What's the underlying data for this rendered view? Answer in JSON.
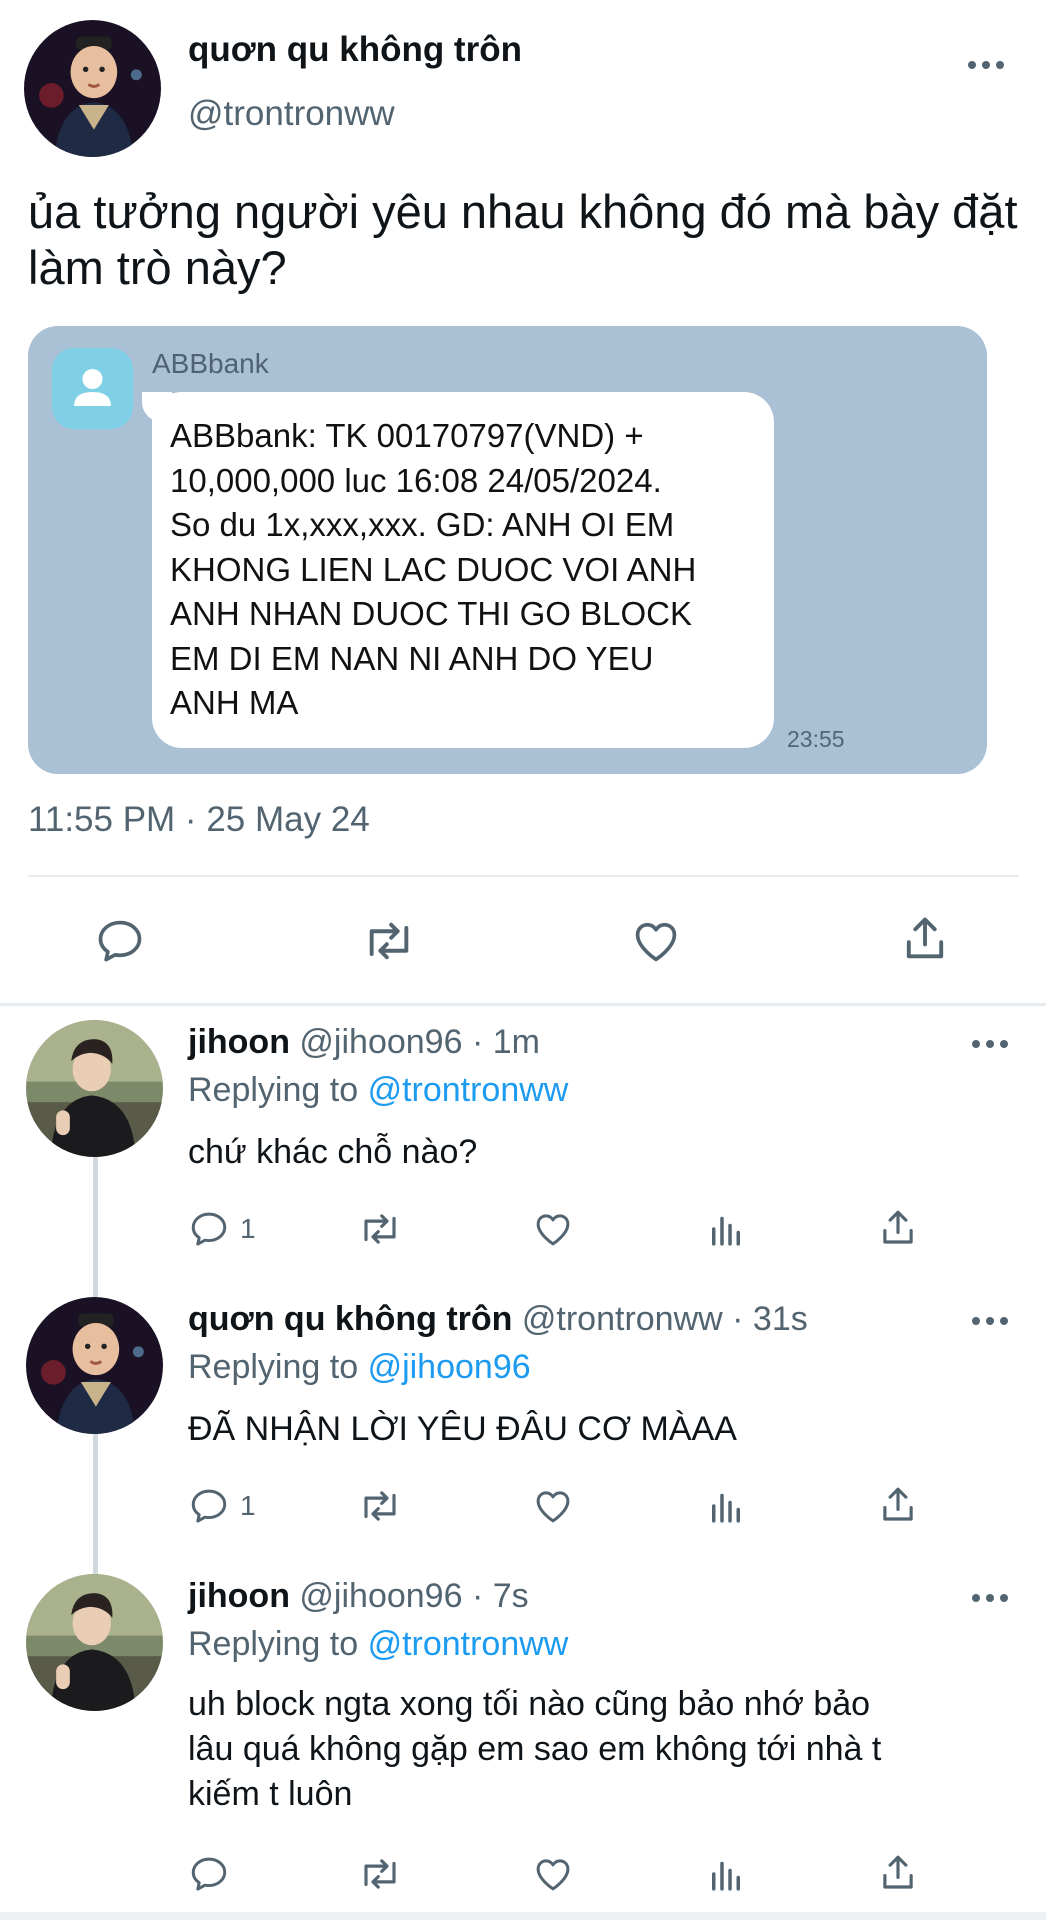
{
  "main_tweet": {
    "author_name": "quơn qu không trôn",
    "author_handle": "@trontronww",
    "text": "ủa tưởng người yêu nhau không đó mà bày đặt làm trò này?",
    "timestamp": "11:55 PM · 25 May 24",
    "sms_image": {
      "sender": "ABBbank",
      "message": "ABBbank: TK 00170797(VND) +\n10,000,000 luc 16:08 24/05/2024.\nSo du 1x,xxx,xxx. GD: ANH OI EM\nKHONG LIEN LAC DUOC VOI ANH\nANH NHAN DUOC THI GO BLOCK\nEM DI EM NAN NI ANH DO YEU\nANH MA",
      "time": "23:55"
    },
    "actions": [
      "reply-icon",
      "retweet-icon",
      "like-icon",
      "share-icon"
    ]
  },
  "replies": [
    {
      "name": "jihoon",
      "handle": "@jihoon96",
      "time": "· 1m",
      "replying_prefix": "Replying to",
      "replying_to": "@trontronww",
      "text": "chứ khác chỗ nào?",
      "reply_count": "1"
    },
    {
      "name": "quơn qu không trôn",
      "handle": "@trontronww",
      "time": "· 31s",
      "replying_prefix": "Replying to",
      "replying_to": "@jihoon96",
      "text": "ĐÃ NHẬN LỜI YÊU ĐÂU CƠ MÀAA",
      "reply_count": "1"
    },
    {
      "name": "jihoon",
      "handle": "@jihoon96",
      "time": "· 7s",
      "replying_prefix": "Replying to",
      "replying_to": "@trontronww",
      "text": "uh block ngta xong tối nào cũng bảo nhớ bảo\nlâu quá không gặp em sao em không tới nhà t\nkiếm t luôn",
      "reply_count": ""
    }
  ],
  "colors": {
    "text_primary": "#0f1419",
    "text_secondary": "#536471",
    "mention": "#1d9bf0",
    "sms_card_bg": "#aac0d4",
    "sms_avatar_bg": "#7fd0e6"
  }
}
